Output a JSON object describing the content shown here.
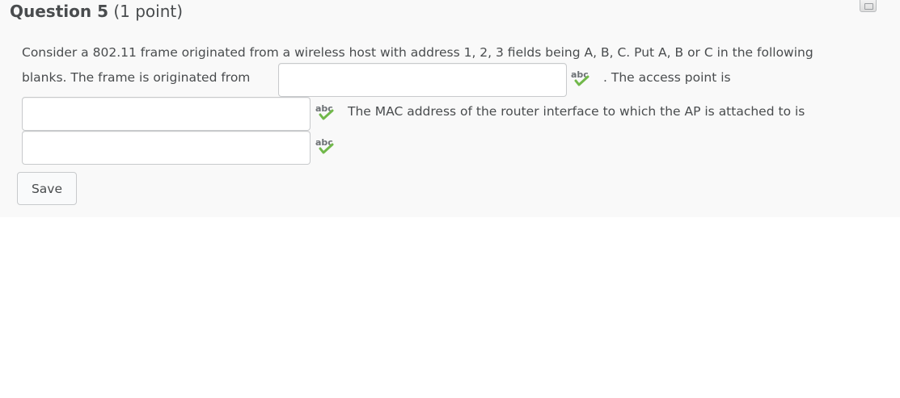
{
  "question": {
    "number_label": "Question 5",
    "points_label": "(1 point)",
    "flag_icon": "flag-question-icon"
  },
  "body": {
    "line1": "Consider a 802.11 frame originated from a wireless host with address 1, 2, 3 fields being A, B, C. Put A, B or C in the following",
    "line2_prefix": "blanks. The frame is originated from",
    "after_blank1": ". The access point is",
    "after_blank2": "The MAC address of the router interface to which the AP is attached to is"
  },
  "blanks": [
    {
      "value": "",
      "placeholder": ""
    },
    {
      "value": "",
      "placeholder": ""
    },
    {
      "value": "",
      "placeholder": ""
    }
  ],
  "spellcheck_icon": {
    "name": "spellcheck-icon",
    "glyph_text": "abc",
    "text_color": "#6d7175",
    "check_color": "#71b84a"
  },
  "actions": {
    "save_label": "Save"
  }
}
